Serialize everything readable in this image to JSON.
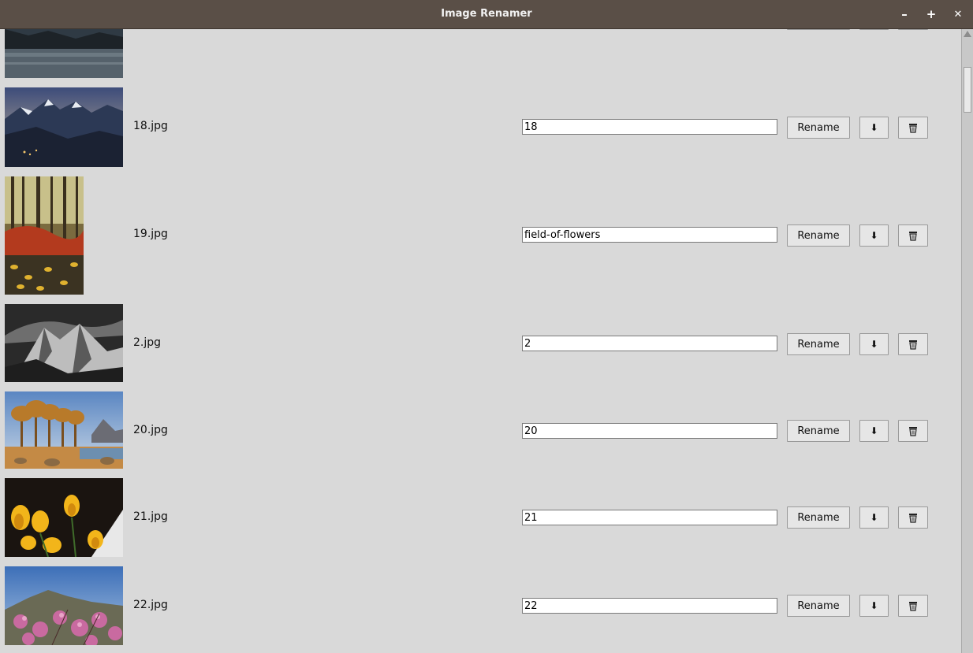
{
  "window": {
    "title": "Image Renamer"
  },
  "controls": {
    "minimize": "–",
    "maximize": "+",
    "close": "✕"
  },
  "rows": [
    {
      "filename": "18.jpg",
      "name_value": "18",
      "rename_label": "Rename",
      "download_icon": "down-arrow-icon",
      "delete_icon": "trash-icon"
    },
    {
      "filename": "19.jpg",
      "name_value": "field-of-flowers",
      "rename_label": "Rename",
      "download_icon": "down-arrow-icon",
      "delete_icon": "trash-icon"
    },
    {
      "filename": "2.jpg",
      "name_value": "2",
      "rename_label": "Rename",
      "download_icon": "down-arrow-icon",
      "delete_icon": "trash-icon"
    },
    {
      "filename": "20.jpg",
      "name_value": "20",
      "rename_label": "Rename",
      "download_icon": "down-arrow-icon",
      "delete_icon": "trash-icon"
    },
    {
      "filename": "21.jpg",
      "name_value": "21",
      "rename_label": "Rename",
      "download_icon": "down-arrow-icon",
      "delete_icon": "trash-icon"
    },
    {
      "filename": "22.jpg",
      "name_value": "22",
      "rename_label": "Rename",
      "download_icon": "down-arrow-icon",
      "delete_icon": "trash-icon"
    }
  ],
  "icons": {
    "download": "⬇"
  },
  "colors": {
    "titlebar": "#5a4f47",
    "background": "#d9d9d9"
  }
}
